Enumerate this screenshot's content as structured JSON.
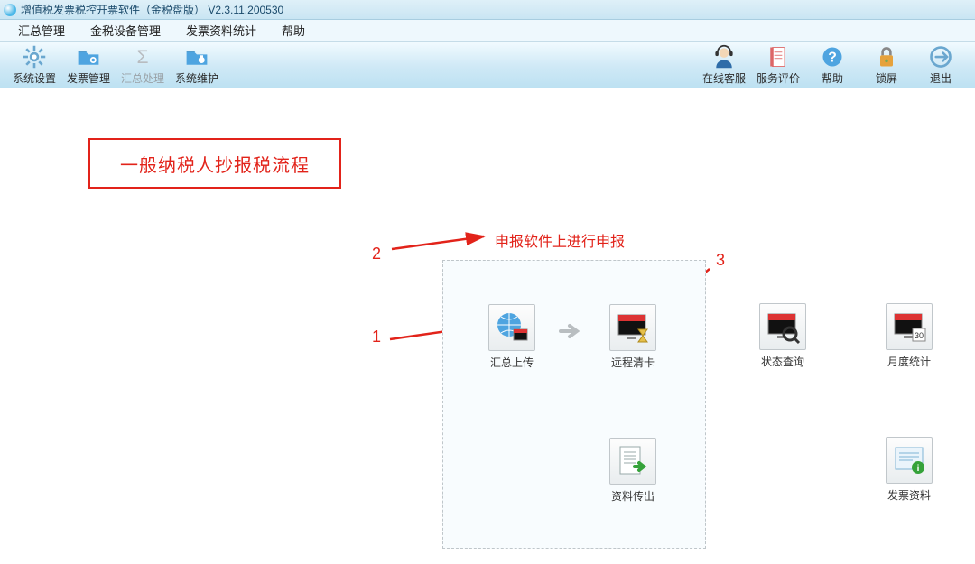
{
  "window": {
    "title": "增值税发票税控开票软件（金税盘版） V2.3.11.200530"
  },
  "menubar": {
    "items": [
      "汇总管理",
      "金税设备管理",
      "发票资料统计",
      "帮助"
    ]
  },
  "toolbar": {
    "left": [
      {
        "name": "system-settings-button",
        "label": "系统设置",
        "icon": "gear"
      },
      {
        "name": "invoice-manage-button",
        "label": "发票管理",
        "icon": "folder-gear"
      },
      {
        "name": "summary-process-button",
        "label": "汇总处理",
        "icon": "sigma",
        "disabled": true
      },
      {
        "name": "system-maint-button",
        "label": "系统维护",
        "icon": "folder-wrench"
      }
    ],
    "right": [
      {
        "name": "online-service-button",
        "label": "在线客服",
        "icon": "agent"
      },
      {
        "name": "service-rating-button",
        "label": "服务评价",
        "icon": "doc"
      },
      {
        "name": "help-button",
        "label": "帮助",
        "icon": "help"
      },
      {
        "name": "lock-button",
        "label": "锁屏",
        "icon": "lock"
      },
      {
        "name": "exit-button",
        "label": "退出",
        "icon": "exit"
      }
    ]
  },
  "callout": {
    "process_title": "一般纳税人抄报税流程",
    "step1": "1",
    "step2": "2",
    "step3": "3",
    "note": "申报软件上进行申报"
  },
  "panel": {
    "upload": {
      "label": "汇总上传"
    },
    "clear": {
      "label": "远程清卡"
    },
    "export": {
      "label": "资料传出"
    }
  },
  "side": {
    "status": {
      "label": "状态查询"
    },
    "monthly": {
      "label": "月度统计"
    },
    "invoice": {
      "label": "发票资料"
    }
  },
  "colors": {
    "red": "#e2231a",
    "accent": "#3aa0e0"
  }
}
